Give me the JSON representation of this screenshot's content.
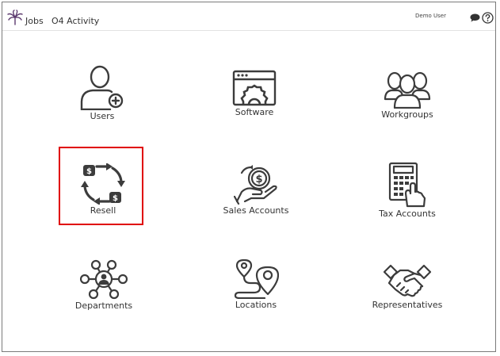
{
  "header": {
    "nav": [
      "Jobs",
      "O4 Activity"
    ],
    "user": "Demo User",
    "icons": [
      "palm-logo-icon",
      "chat-icon",
      "help-icon"
    ]
  },
  "tiles": [
    {
      "label": "Users",
      "icon": "user-add-icon"
    },
    {
      "label": "Software",
      "icon": "software-gear-icon"
    },
    {
      "label": "Workgroups",
      "icon": "workgroups-icon"
    },
    {
      "label": "Resell",
      "icon": "resell-cycle-icon"
    },
    {
      "label": "Sales Accounts",
      "icon": "sales-hand-coin-icon"
    },
    {
      "label": "Tax Accounts",
      "icon": "calculator-icon"
    },
    {
      "label": "Departments",
      "icon": "departments-network-icon"
    },
    {
      "label": "Locations",
      "icon": "locations-route-icon"
    },
    {
      "label": "Representatives",
      "icon": "handshake-icon"
    }
  ],
  "colors": {
    "icon": "#3c3c3c",
    "highlight": "#e00000",
    "logo": "#5c3a6e"
  },
  "highlighted_tile": "Resell"
}
